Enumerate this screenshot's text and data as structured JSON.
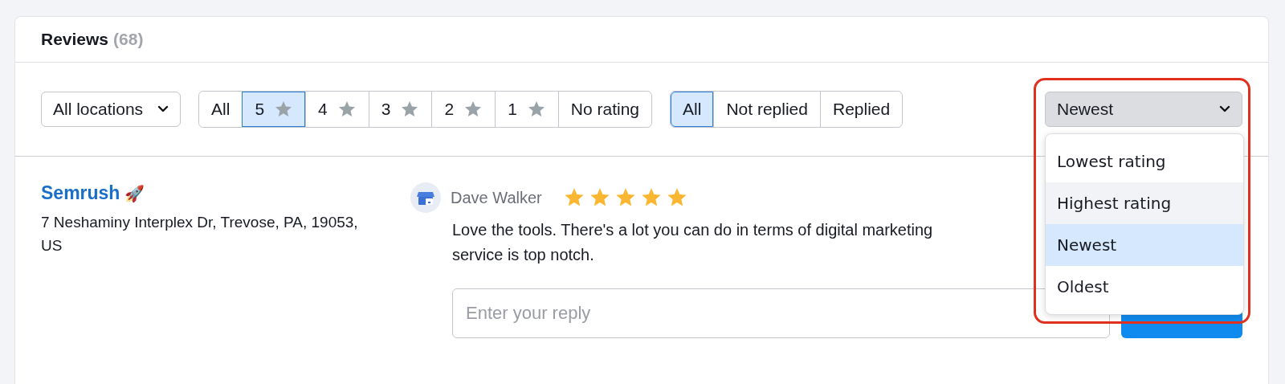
{
  "header": {
    "title": "Reviews",
    "count": "(68)"
  },
  "filters": {
    "location": {
      "value": "All locations"
    },
    "ratings": [
      {
        "label": "All",
        "kind": "text",
        "selected": false
      },
      {
        "label": "5",
        "kind": "star",
        "selected": true
      },
      {
        "label": "4",
        "kind": "star",
        "selected": false
      },
      {
        "label": "3",
        "kind": "star",
        "selected": false
      },
      {
        "label": "2",
        "kind": "star",
        "selected": false
      },
      {
        "label": "1",
        "kind": "star",
        "selected": false
      },
      {
        "label": "No rating",
        "kind": "text",
        "selected": false
      }
    ],
    "reply_status": [
      {
        "label": "All",
        "selected": true
      },
      {
        "label": "Not replied",
        "selected": false
      },
      {
        "label": "Replied",
        "selected": false
      }
    ],
    "sort": {
      "value": "Newest",
      "expanded": true,
      "highlighted_frame": true,
      "options": [
        {
          "label": "Lowest rating",
          "selected": false,
          "hovered": false
        },
        {
          "label": "Highest rating",
          "selected": false,
          "hovered": true
        },
        {
          "label": "Newest",
          "selected": true,
          "hovered": false
        },
        {
          "label": "Oldest",
          "selected": false,
          "hovered": false
        }
      ]
    }
  },
  "review": {
    "business": {
      "name": "Semrush",
      "emoji": "🚀",
      "address": "7 Neshaminy Interplex Dr, Trevose, PA, 19053, US"
    },
    "author": "Dave Walker",
    "stars": 5,
    "text_lines": [
      "Love the tools. There's a lot you can do in terms of digital marketing",
      "service is top notch."
    ],
    "reply": {
      "placeholder": "Enter your reply"
    }
  }
}
